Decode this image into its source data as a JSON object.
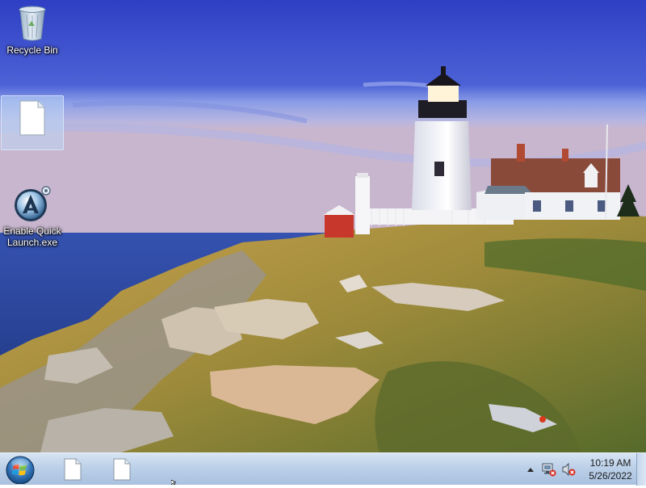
{
  "desktop": {
    "icons": [
      {
        "label": "Recycle Bin",
        "icon": "recycle-bin-icon"
      },
      {
        "label": "",
        "icon": "blank-file-icon",
        "selected": true
      },
      {
        "label": "Enable Quick Launch.exe",
        "icon": "quick-launch-app-icon"
      }
    ]
  },
  "taskbar": {
    "start_icon": "windows-start-orb-icon",
    "buttons": [
      {
        "icon": "blank-file-icon"
      },
      {
        "icon": "blank-file-icon"
      }
    ],
    "tray": {
      "icons": [
        "chevron-up-icon",
        "network-disconnected-icon",
        "volume-muted-icon"
      ],
      "time": "10:19 AM",
      "date": "5/26/2022"
    }
  },
  "colors": {
    "taskbar_top": "#d7e4f3",
    "taskbar_bottom": "#a9c1df",
    "sky": "#3340c8",
    "sea": "#1e3a86",
    "selection": "#bed7f5"
  }
}
